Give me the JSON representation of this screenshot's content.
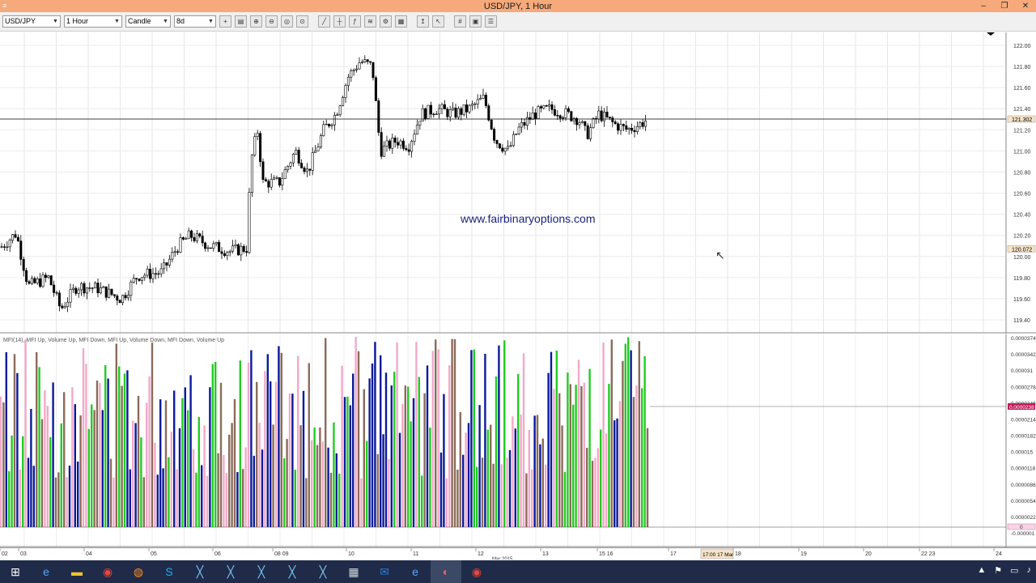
{
  "window": {
    "title": "USD/JPY, 1 Hour",
    "controls": {
      "minimize": "–",
      "restore": "❐",
      "close": "✕"
    }
  },
  "toolbar": {
    "symbol": "USD/JPY",
    "timeframe": "1 Hour",
    "chart_style": "Candle",
    "period": "8d",
    "tools": [
      "crosshair-icon",
      "print-icon",
      "zoom-in-icon",
      "zoom-out-icon",
      "zoom-fit-icon",
      "zoom-reset-icon",
      "draw-line-icon",
      "fib-icon",
      "indicator-icon",
      "template-icon",
      "settings-icon",
      "calculator-icon",
      "buy-icon",
      "pointer-icon",
      "grid-icon",
      "save-icon",
      "properties-icon"
    ]
  },
  "watermark": "www.fairbinaryoptions.com",
  "price_axis": {
    "ticks": [
      "122.00",
      "121.80",
      "121.60",
      "121.40",
      "121.20",
      "121.00",
      "120.80",
      "120.60",
      "120.40",
      "120.20",
      "120.00",
      "119.80",
      "119.60",
      "119.40"
    ],
    "current_label": "121.302",
    "marker_label": "120.072"
  },
  "indicator": {
    "legend": "MFI(14), MFI Up, Volume Up, MFI Down, MFI Up, Volume Down, MFI Down, Volume Up",
    "ticks": [
      "0.0000374",
      "0.0000342",
      "0.000031",
      "0.0000278",
      "0.0000246",
      "0.0000214",
      "0.0000182",
      "0.000015",
      "0.0000118",
      "0.0000086",
      "0.0000054",
      "0.0000022",
      "-0.000001"
    ],
    "current_label": "0.0000238",
    "zero_label": "0"
  },
  "x_axis": {
    "labels": [
      "02",
      "03",
      "04",
      "05",
      "06",
      "08 09",
      "10",
      "11",
      "12",
      "13",
      "15 16",
      "17",
      "18",
      "19",
      "20",
      "22 23",
      "24"
    ],
    "month_label": "Mar 2015",
    "cursor_label": "17:00 17 Mar"
  },
  "chart_data": {
    "type": "candlestick",
    "title": "USD/JPY, 1 Hour",
    "ylim": [
      119.3,
      122.2
    ],
    "current_price": 121.302,
    "marker_price": 120.072,
    "close_path": [
      [
        0,
        120.08
      ],
      [
        20,
        120.22
      ],
      [
        35,
        119.72
      ],
      [
        60,
        119.8
      ],
      [
        75,
        119.5
      ],
      [
        95,
        119.72
      ],
      [
        120,
        119.7
      ],
      [
        150,
        119.6
      ],
      [
        170,
        119.82
      ],
      [
        200,
        119.85
      ],
      [
        220,
        120.1
      ],
      [
        235,
        120.2
      ],
      [
        260,
        120.1
      ],
      [
        285,
        120.05
      ],
      [
        305,
        120.08
      ],
      [
        310,
        120.9
      ],
      [
        318,
        121.2
      ],
      [
        325,
        120.7
      ],
      [
        345,
        120.7
      ],
      [
        365,
        121.0
      ],
      [
        380,
        120.8
      ],
      [
        400,
        121.2
      ],
      [
        415,
        121.35
      ],
      [
        430,
        121.7
      ],
      [
        445,
        121.85
      ],
      [
        460,
        121.8
      ],
      [
        470,
        121.0
      ],
      [
        490,
        121.1
      ],
      [
        505,
        121.05
      ],
      [
        520,
        121.35
      ],
      [
        540,
        121.4
      ],
      [
        560,
        121.35
      ],
      [
        580,
        121.4
      ],
      [
        598,
        121.5
      ],
      [
        612,
        121.1
      ],
      [
        628,
        121.0
      ],
      [
        640,
        121.2
      ],
      [
        660,
        121.35
      ],
      [
        680,
        121.4
      ],
      [
        700,
        121.35
      ],
      [
        715,
        121.3
      ],
      [
        725,
        121.15
      ],
      [
        740,
        121.35
      ],
      [
        760,
        121.25
      ],
      [
        775,
        121.2
      ],
      [
        790,
        121.25
      ],
      [
        800,
        121.3
      ]
    ]
  },
  "colors": {
    "mfi_up": "#22cc22",
    "mfi_down": "#f2a9c9",
    "volume_up": "#0a1a9a",
    "volume_down": "#8b6b5a",
    "candle": "#000000",
    "titlebar": "#f6a97a",
    "current_line": "#000000",
    "price_label_bg": "#f7e3c8"
  },
  "taskbar": {
    "icons": [
      "windows-start-icon",
      "ie-icon",
      "explorer-icon",
      "chrome-icon",
      "firefox-icon",
      "skype-icon",
      "metatrader-icon",
      "metatrader-icon",
      "metatrader-icon",
      "metatrader-icon",
      "metatrader-icon",
      "calculator-icon",
      "outlook-icon",
      "ie-icon",
      "app-icon",
      "chrome-icon"
    ]
  }
}
